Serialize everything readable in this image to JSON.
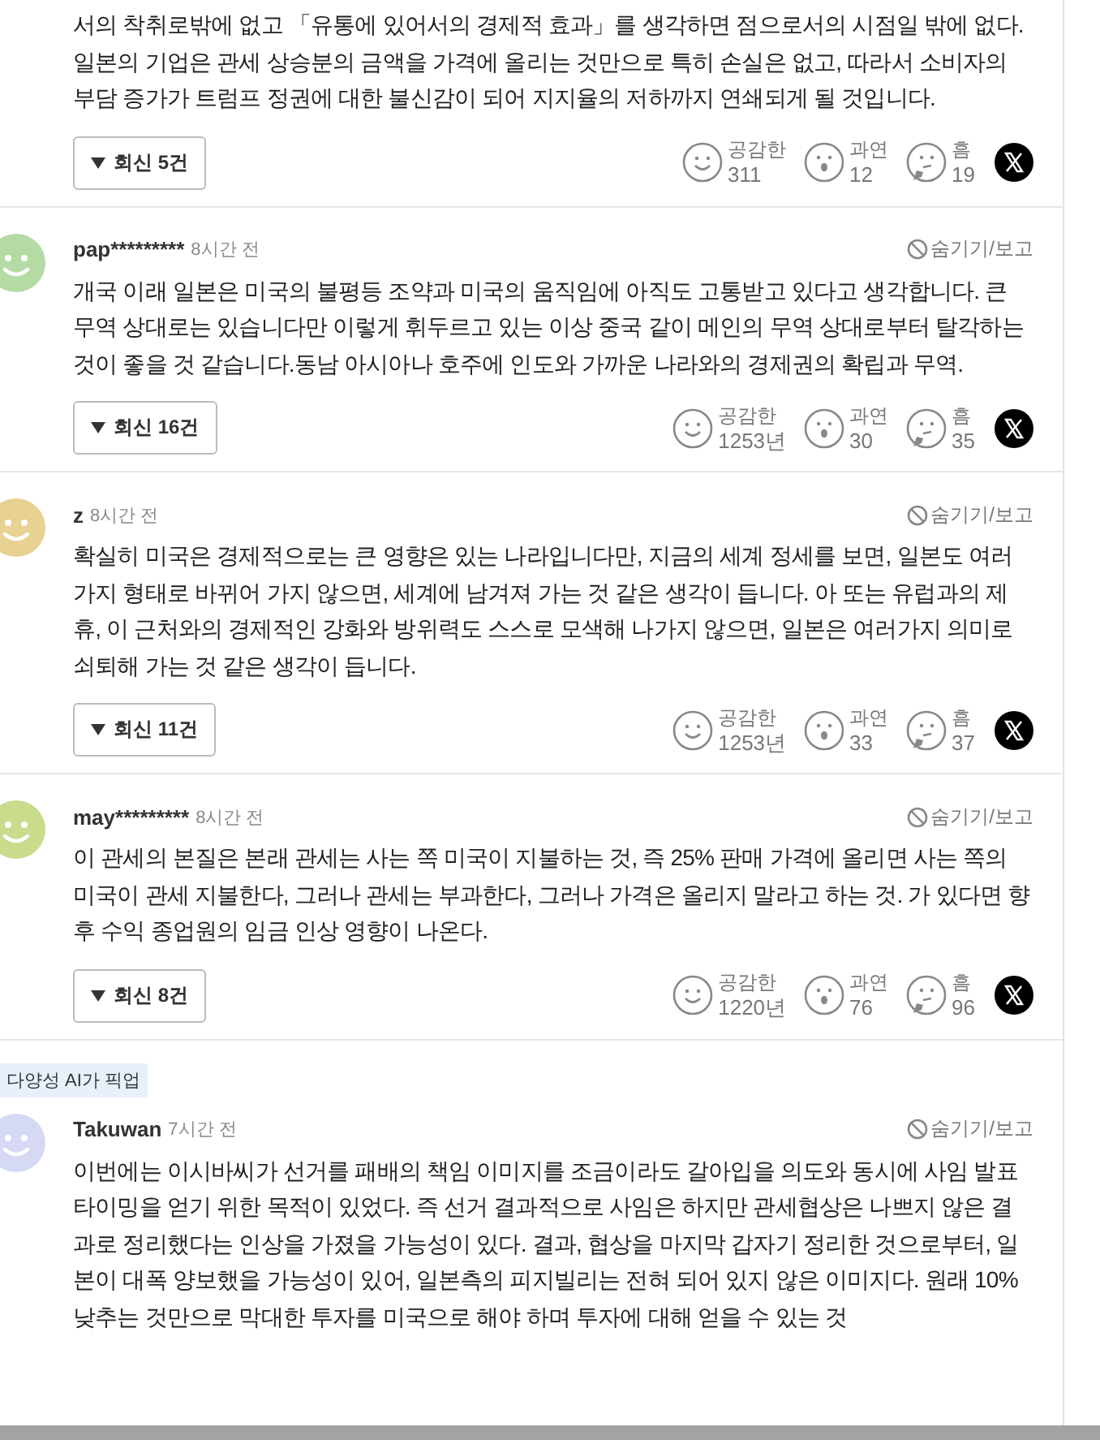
{
  "comments": [
    {
      "text": "서의 착취로밖에 없고 「유통에 있어서의 경제적 효과」를 생각하면 점으로서의 시점일 밖에 없다. 일본의 기업은 관세 상승분의 금액을 가격에 올리는 것만으로 특히 손실은 없고, 따라서 소비자의 부담 증가가 트럼프 정권에 대한 불신감이 되어 지지율의 저하까지 연쇄되게 될 것입니다.",
      "replies": "회신 5건",
      "reactions": [
        {
          "kind": "smile",
          "label": "공감한",
          "count": "311"
        },
        {
          "kind": "surprise",
          "label": "과연",
          "count": "12"
        },
        {
          "kind": "hmm",
          "label": "흠",
          "count": "19"
        }
      ]
    },
    {
      "author": "pap*********",
      "time": "8시간 전",
      "color": "#b5dba5",
      "hide": "숨기기/보고",
      "text": "개국 이래 일본은 미국의 불평등 조약과 미국의 움직임에 아직도 고통받고 있다고 생각합니다. 큰 무역 상대로는 있습니다만 이렇게 휘두르고 있는 이상 중국 같이 메인의 무역 상대로부터 탈각하는 것이 좋을 것 같습니다.동남 아시아나 호주에 인도와 가까운 나라와의 경제권의 확립과 무역.",
      "replies": "회신 16건",
      "reactions": [
        {
          "kind": "smile",
          "label": "공감한",
          "count": "1253년"
        },
        {
          "kind": "surprise",
          "label": "과연",
          "count": "30"
        },
        {
          "kind": "hmm",
          "label": "흠",
          "count": "35"
        }
      ]
    },
    {
      "author": "z",
      "time": "8시간 전",
      "color": "#e8d291",
      "hide": "숨기기/보고",
      "text": "확실히 미국은 경제적으로는 큰 영향은 있는 나라입니다만, 지금의 세계 정세를 보면, 일본도 여러가지 형태로 바뀌어 가지 않으면, 세계에 남겨져 가는 것 같은 생각이 듭니다. 아 또는 유럽과의 제휴, 이 근처와의 경제적인 강화와 방위력도 스스로 모색해 나가지 않으면, 일본은 여러가지 의미로 쇠퇴해 가는 것 같은 생각이 듭니다.",
      "replies": "회신 11건",
      "reactions": [
        {
          "kind": "smile",
          "label": "공감한",
          "count": "1253년"
        },
        {
          "kind": "surprise",
          "label": "과연",
          "count": "33"
        },
        {
          "kind": "hmm",
          "label": "흠",
          "count": "37"
        }
      ]
    },
    {
      "author": "may*********",
      "time": "8시간 전",
      "color": "#c8dc8c",
      "hide": "숨기기/보고",
      "text": "이 관세의 본질은 본래 관세는 사는 쪽 미국이 지불하는 것, 즉 25% 판매 가격에 올리면 사는 쪽의 미국이 관세 지불한다, 그러나 관세는 부과한다, 그러나 가격은 올리지 말라고 하는 것. 가 있다면 향후 수익 종업원의 임금 인상 영향이 나온다.",
      "replies": "회신 8건",
      "reactions": [
        {
          "kind": "smile",
          "label": "공감한",
          "count": "1220년"
        },
        {
          "kind": "surprise",
          "label": "과연",
          "count": "76"
        },
        {
          "kind": "hmm",
          "label": "흠",
          "count": "96"
        }
      ]
    },
    {
      "badge": "다양성 AI가 픽업",
      "author": "Takuwan",
      "time": "7시간 전",
      "color": "#d5d9f3",
      "hide": "숨기기/보고",
      "text": "이번에는 이시바씨가 선거를 패배의 책임 이미지를 조금이라도 갈아입을 의도와 동시에 사임 발표 타이밍을 얻기 위한 목적이 있었다. 즉 선거 결과적으로 사임은 하지만 관세협상은 나쁘지 않은 결과로 정리했다는 인상을 가졌을 가능성이 있다. 결과, 협상을 마지막 갑자기 정리한 것으로부터, 일본이 대폭 양보했을 가능성이 있어, 일본측의 피지빌리는 전혀 되어 있지 않은 이미지다. 원래 10% 낮추는 것만으로 막대한 투자를 미국으로 해야 하며 투자에 대해 얻을 수 있는 것"
    }
  ]
}
